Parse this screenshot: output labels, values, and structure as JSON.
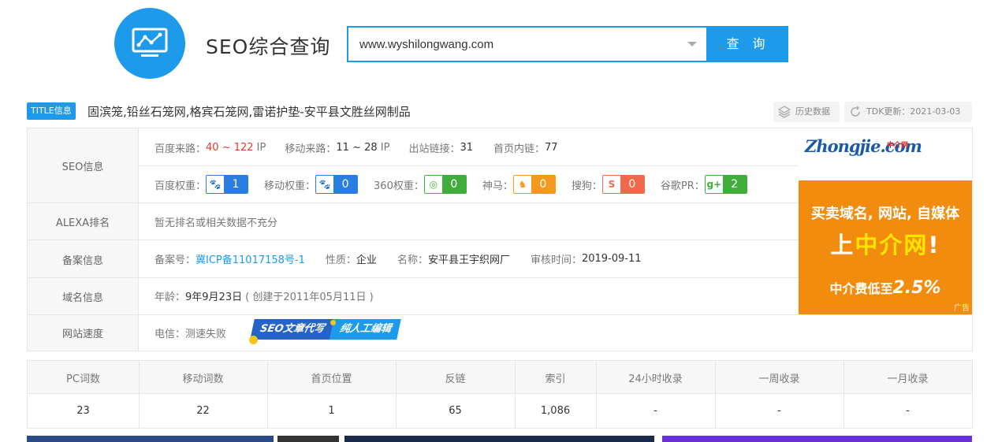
{
  "app": {
    "title": "SEO综合查询"
  },
  "search": {
    "value": "www.wyshilongwang.com",
    "button": "查 询"
  },
  "site_title": {
    "tag": "TITLE信息",
    "text": "固滨笼,铅丝石笼网,格宾石笼网,雷诺护垫-安平县文胜丝网制品"
  },
  "actions": {
    "history": "历史数据",
    "tdk_update": "TDK更新：2021-03-03"
  },
  "seo": {
    "label": "SEO信息",
    "baidu_traffic_label": "百度来路：",
    "baidu_traffic_value": "40 ~ 122",
    "baidu_traffic_unit": "IP",
    "mobile_traffic_label": "移动来路：",
    "mobile_traffic_value": "11 ~ 28",
    "mobile_traffic_unit": "IP",
    "outlinks_label": "出站链接：",
    "outlinks_value": "31",
    "inlinks_label": "首页内链：",
    "inlinks_value": "77",
    "ranks": [
      {
        "label": "百度权重：",
        "value": "1",
        "color": "#2a7de1",
        "icon": "paw-icon"
      },
      {
        "label": "移动权重：",
        "value": "0",
        "color": "#2a7de1",
        "icon": "mobile-paw-icon"
      },
      {
        "label": "360权重：",
        "value": "0",
        "color": "#3fae3a",
        "icon": "ring-360-icon"
      },
      {
        "label": "神马：",
        "value": "0",
        "color": "#f39a1e",
        "icon": "horse-icon"
      },
      {
        "label": "搜狗：",
        "value": "0",
        "color": "#ef6a4a",
        "icon": "sogou-icon"
      },
      {
        "label": "谷歌PR：",
        "value": "2",
        "color": "#3fae3a",
        "icon": "google-plus-icon"
      }
    ]
  },
  "alexa": {
    "label": "ALEXA排名",
    "value": "暂无排名或相关数据不充分"
  },
  "icp": {
    "label": "备案信息",
    "no_label": "备案号：",
    "no_value": "冀ICP备11017158号-1",
    "type_label": "性质：",
    "type_value": "企业",
    "name_label": "名称：",
    "name_value": "安平县王宇织网厂",
    "date_label": "审核时间：",
    "date_value": "2019-09-11"
  },
  "domain": {
    "label": "域名信息",
    "age_label": "年龄：",
    "age_value": "9年9月23日",
    "created": "( 创建于2011年05月11日 )"
  },
  "speed": {
    "label": "网站速度",
    "value": "电信：测速失败",
    "promo1": "SEO文章代写",
    "promo2": "纯人工编辑"
  },
  "ad": {
    "logo": "Zhongjie.com",
    "logo_cn": "中介网",
    "line1": "买卖域名, 网站, 自媒体",
    "line2_a": "上",
    "line2_b": "中介网",
    "line2_c": "!",
    "line3_a": "中介费低至",
    "line3_b": "2.5%",
    "tag": "广告"
  },
  "stats": {
    "headers": [
      "PC词数",
      "移动词数",
      "首页位置",
      "反链",
      "索引",
      "24小时收录",
      "一周收录",
      "一月收录"
    ],
    "values": [
      "23",
      "22",
      "1",
      "65",
      "1,086",
      "-",
      "-",
      "-"
    ]
  },
  "colors": {
    "accent": "#1e9aea",
    "ad_orange": "#f28c0f"
  }
}
